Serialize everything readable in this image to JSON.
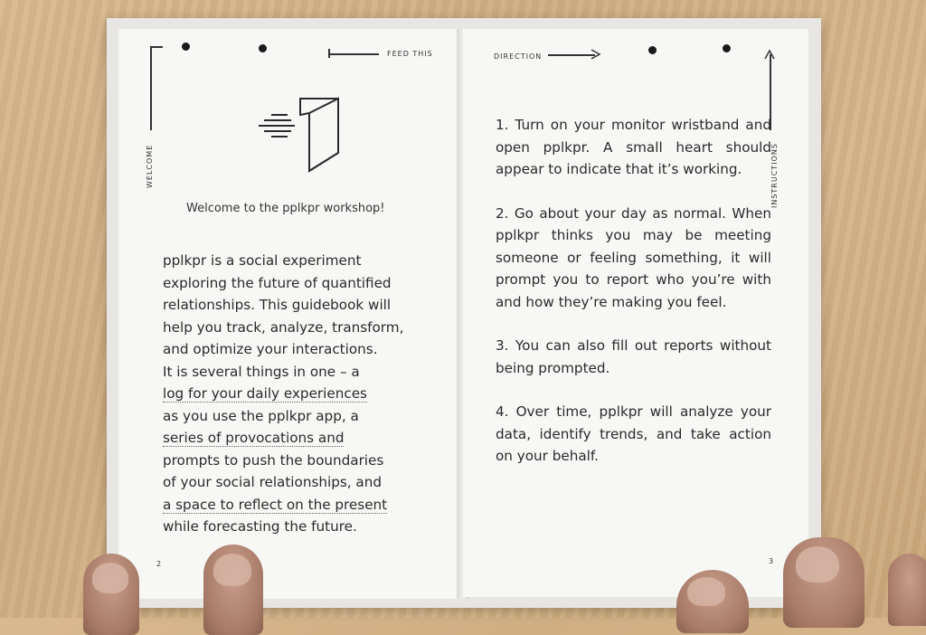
{
  "left_page": {
    "header_label": "FEED THIS",
    "side_label": "WELCOME",
    "icon": "door-with-arrow-icon",
    "welcome": "Welcome to the pplkpr workshop!",
    "body_lines": [
      "pplkpr is a social experiment",
      "exploring the future of quantified",
      "relationships. This guidebook will",
      "help you track, analyze, transform,",
      "and optimize your interactions.",
      "It is several things in one – a",
      "log for your daily experiences",
      "as you use the pplkpr app, a",
      "series of provocations and",
      "prompts to push the boundaries",
      "of your social relationships, and",
      "a space to reflect on the present",
      "while forecasting the future."
    ],
    "page_number": "2"
  },
  "right_page": {
    "header_label": "DIRECTION",
    "side_label": "INSTRUCTIONS",
    "steps": [
      "1. Turn on your monitor wristband and open pplkpr. A small heart should appear to indicate that it’s working.",
      "2. Go about your day as normal. When pplkpr thinks you may be meeting someone or feeling something, it will prompt you to report who you’re with and how they’re making you feel.",
      "3. You can also fill out reports without being prompted.",
      "4. Over time, pplkpr will analyze your data, identify trends, and take action on your behalf."
    ],
    "page_number": "3"
  }
}
